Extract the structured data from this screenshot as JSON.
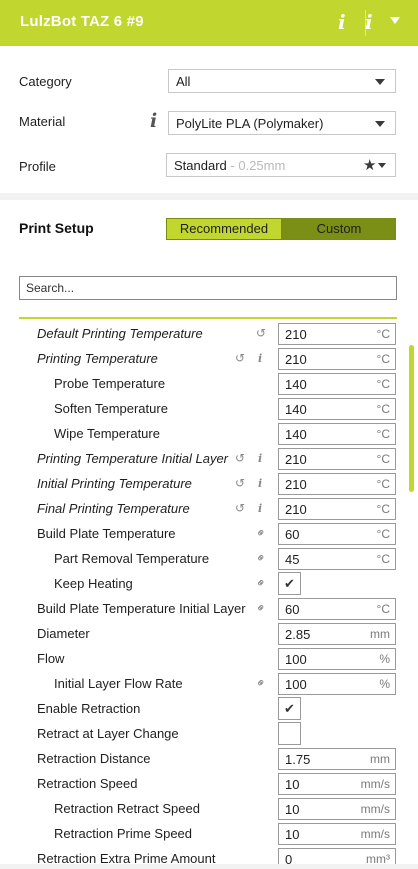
{
  "header": {
    "title": "LulzBot TAZ 6 #9",
    "icons": [
      "info-icon",
      "info-icon",
      "chevron-down-icon"
    ]
  },
  "top_settings": {
    "category": {
      "label": "Category",
      "value": "All"
    },
    "material": {
      "label": "Material",
      "value": "PolyLite PLA (Polymaker)"
    },
    "profile": {
      "label": "Profile",
      "value": "Standard",
      "sub": " - 0.25mm"
    }
  },
  "print_setup": {
    "title": "Print Setup",
    "recommended_label": "Recommended",
    "custom_label": "Custom",
    "search_placeholder": "Search..."
  },
  "settings": [
    {
      "name": "Default Printing Temperature",
      "italic": true,
      "value": "210",
      "unit": "°C",
      "icons": [
        "reset"
      ]
    },
    {
      "name": "Printing Temperature",
      "italic": true,
      "value": "210",
      "unit": "°C",
      "icons": [
        "reset",
        "info"
      ]
    },
    {
      "name": "Probe Temperature",
      "italic": false,
      "indent": 1,
      "value": "140",
      "unit": "°C",
      "icons": []
    },
    {
      "name": "Soften Temperature",
      "italic": false,
      "indent": 1,
      "value": "140",
      "unit": "°C",
      "icons": []
    },
    {
      "name": "Wipe Temperature",
      "italic": false,
      "indent": 1,
      "value": "140",
      "unit": "°C",
      "icons": []
    },
    {
      "name": "Printing Temperature Initial Layer",
      "italic": true,
      "value": "210",
      "unit": "°C",
      "icons": [
        "reset",
        "info"
      ]
    },
    {
      "name": "Initial Printing Temperature",
      "italic": true,
      "value": "210",
      "unit": "°C",
      "icons": [
        "reset",
        "info"
      ]
    },
    {
      "name": "Final Printing Temperature",
      "italic": true,
      "value": "210",
      "unit": "°C",
      "icons": [
        "reset",
        "info"
      ]
    },
    {
      "name": "Build Plate Temperature",
      "italic": false,
      "value": "60",
      "unit": "°C",
      "icons": [
        "link"
      ]
    },
    {
      "name": "Part Removal Temperature",
      "italic": false,
      "indent": 1,
      "value": "45",
      "unit": "°C",
      "icons": [
        "link"
      ]
    },
    {
      "name": "Keep Heating",
      "italic": false,
      "indent": 1,
      "checkbox": true,
      "checked": true,
      "icons": [
        "link"
      ]
    },
    {
      "name": "Build Plate Temperature Initial Layer",
      "italic": false,
      "value": "60",
      "unit": "°C",
      "icons": [
        "link"
      ]
    },
    {
      "name": "Diameter",
      "italic": false,
      "value": "2.85",
      "unit": "mm",
      "icons": []
    },
    {
      "name": "Flow",
      "italic": false,
      "value": "100",
      "unit": "%",
      "icons": []
    },
    {
      "name": "Initial Layer Flow Rate",
      "italic": false,
      "indent": 1,
      "value": "100",
      "unit": "%",
      "icons": [
        "link"
      ]
    },
    {
      "name": "Enable Retraction",
      "italic": false,
      "checkbox": true,
      "checked": true,
      "icons": []
    },
    {
      "name": "Retract at Layer Change",
      "italic": false,
      "checkbox": true,
      "checked": false,
      "icons": []
    },
    {
      "name": "Retraction Distance",
      "italic": false,
      "value": "1.75",
      "unit": "mm",
      "icons": []
    },
    {
      "name": "Retraction Speed",
      "italic": false,
      "value": "10",
      "unit": "mm/s",
      "icons": []
    },
    {
      "name": "Retraction Retract Speed",
      "italic": false,
      "indent": 1,
      "value": "10",
      "unit": "mm/s",
      "icons": []
    },
    {
      "name": "Retraction Prime Speed",
      "italic": false,
      "indent": 1,
      "value": "10",
      "unit": "mm/s",
      "icons": []
    },
    {
      "name": "Retraction Extra Prime Amount",
      "italic": false,
      "value": "0",
      "unit": "mm³",
      "icons": []
    }
  ],
  "colors": {
    "accent": "#c1d72f",
    "custom_button": "#7b8f17"
  }
}
